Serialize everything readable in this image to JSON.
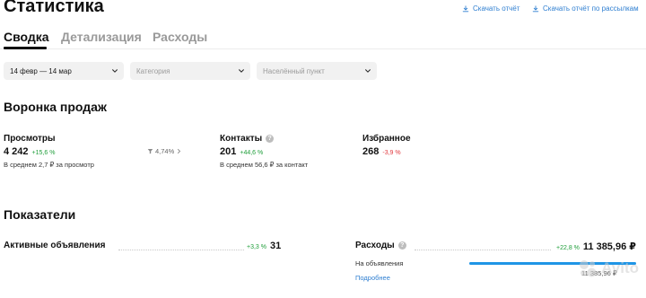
{
  "header": {
    "title": "Статистика",
    "download_report": "Скачать отчёт",
    "download_subscription": "Скачать отчёт по рассылкам"
  },
  "tabs": [
    {
      "label": "Сводка",
      "active": true
    },
    {
      "label": "Детализация",
      "active": false
    },
    {
      "label": "Расходы",
      "active": false
    }
  ],
  "filters": {
    "period": {
      "value": "14 февр — 14 мар"
    },
    "category": {
      "placeholder": "Категория"
    },
    "city": {
      "placeholder": "Населённый пункт"
    }
  },
  "funnel": {
    "title": "Воронка продаж",
    "views": {
      "label": "Просмотры",
      "value": "4 242",
      "delta": "+15,6 %",
      "sub": "В среднем 2,7 ₽ за просмотр"
    },
    "conversion": "4,74%",
    "contacts": {
      "label": "Контакты",
      "value": "201",
      "delta": "+44,6 %",
      "sub": "В среднем 56,6 ₽ за контакт"
    },
    "favorites": {
      "label": "Избранное",
      "value": "268",
      "delta": "-3,9 %"
    }
  },
  "indicators": {
    "title": "Показатели",
    "active_ads": {
      "label": "Активные объявления",
      "delta": "+3,3 %",
      "value": "31"
    },
    "expenses": {
      "label": "Расходы",
      "delta": "+22,8 %",
      "value": "11 385,96 ₽",
      "breakdown": [
        {
          "label": "На объявления",
          "value": "11 385,96 ₽",
          "share": 1.0
        }
      ],
      "more": "Подробнее"
    }
  },
  "watermark": "Avito",
  "colors": {
    "accent_link": "#2f7fd1",
    "positive": "#1f9e3a",
    "negative": "#e0373c",
    "bar": "#1f95e6"
  }
}
